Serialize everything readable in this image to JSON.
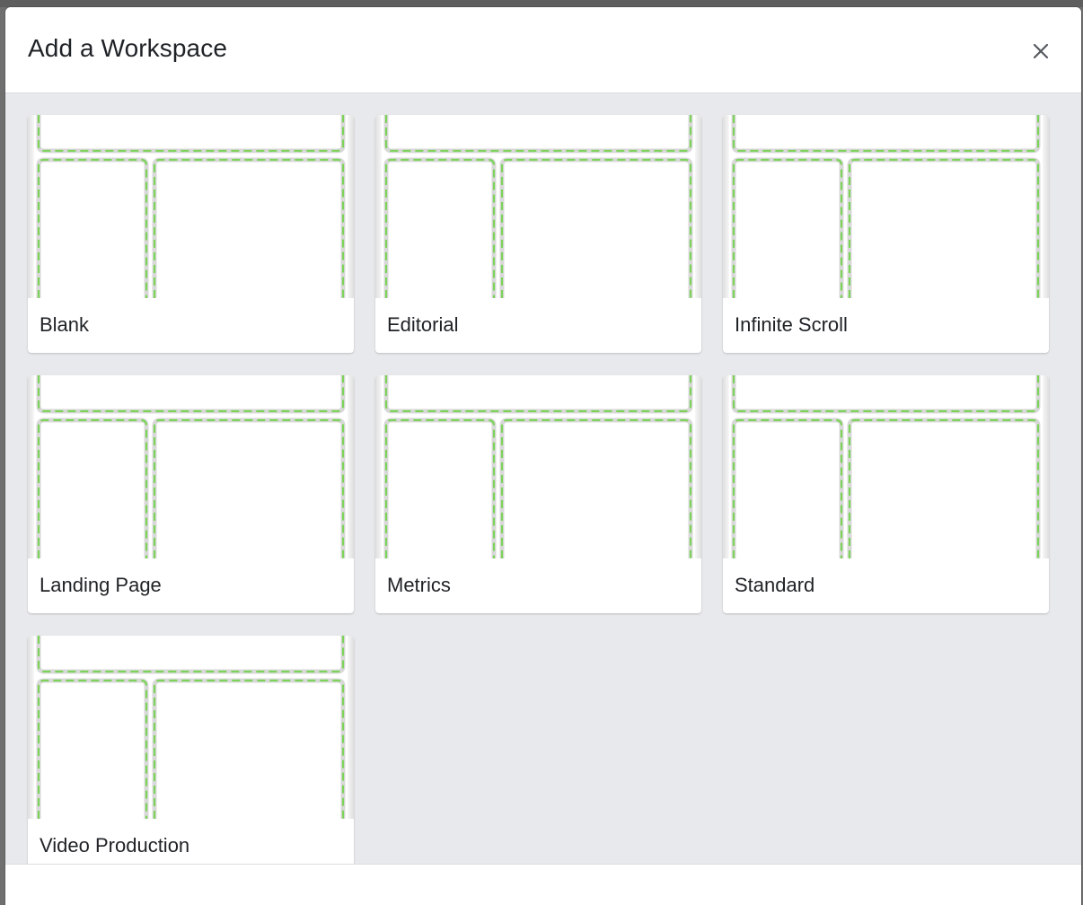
{
  "modal": {
    "title": "Add a Workspace",
    "close_icon": "close-icon"
  },
  "templates": [
    {
      "label": "Blank"
    },
    {
      "label": "Editorial"
    },
    {
      "label": "Infinite Scroll"
    },
    {
      "label": "Landing Page"
    },
    {
      "label": "Metrics"
    },
    {
      "label": "Standard"
    },
    {
      "label": "Video Production"
    }
  ],
  "colors": {
    "dashed_outline": "#7dd35a",
    "body_background": "#e8e9ec"
  }
}
